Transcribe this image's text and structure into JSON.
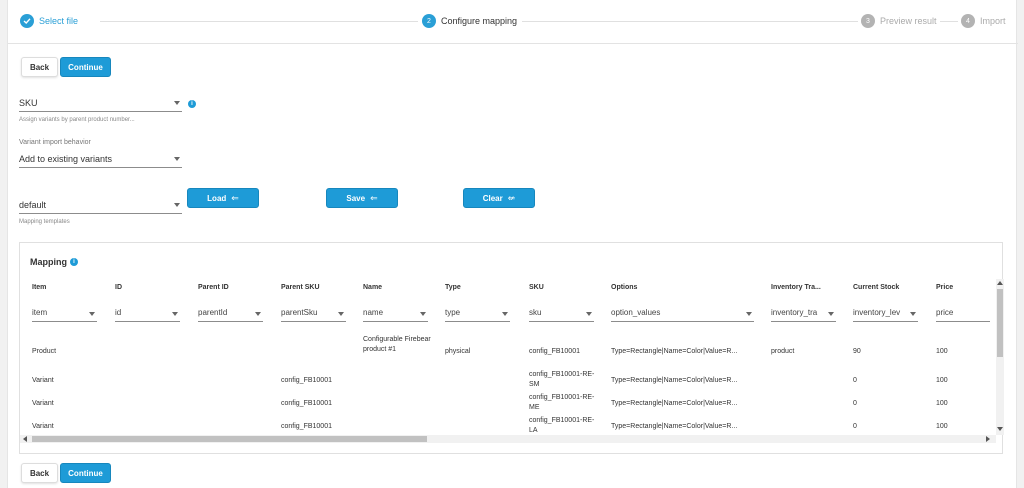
{
  "stepper": {
    "steps": [
      {
        "num": "✓",
        "label": "Select file",
        "state": "done"
      },
      {
        "num": "2",
        "label": "Configure mapping",
        "state": "active"
      },
      {
        "num": "3",
        "label": "Preview result",
        "state": "todo"
      },
      {
        "num": "4",
        "label": "Import",
        "state": "todo"
      }
    ]
  },
  "top_buttons": {
    "back_label": "Back",
    "continue_label": "Continue"
  },
  "bottom_buttons": {
    "back_label": "Back",
    "continue_label": "Continue"
  },
  "sku_field": {
    "value": "SKU",
    "help": "Assign variants by parent product number..."
  },
  "variant_behavior": {
    "caption": "Variant import behavior",
    "value": "Add to existing variants"
  },
  "template_field": {
    "value": "default",
    "help": "Mapping templates"
  },
  "template_buttons": {
    "load_label": "Load",
    "save_label": "Save",
    "clear_label": "Clear"
  },
  "mapping": {
    "title": "Mapping",
    "columns": [
      {
        "header": "Item",
        "select": "item"
      },
      {
        "header": "ID",
        "select": "id"
      },
      {
        "header": "Parent ID",
        "select": "parentId"
      },
      {
        "header": "Parent SKU",
        "select": "parentSku"
      },
      {
        "header": "Name",
        "select": "name"
      },
      {
        "header": "Type",
        "select": "type"
      },
      {
        "header": "SKU",
        "select": "sku"
      },
      {
        "header": "Options",
        "select": "option_values"
      },
      {
        "header": "Inventory Tra...",
        "select": "inventory_tra"
      },
      {
        "header": "Current Stock",
        "select": "inventory_lev"
      },
      {
        "header": "Price",
        "select": "price"
      }
    ],
    "rows": [
      {
        "item": "Product",
        "id": "",
        "parent_id": "",
        "parent_sku": "",
        "name": "Configurable Firebear product #1",
        "type": "physical",
        "sku": "config_FB10001",
        "options": "Type=Rectangle|Name=Color|Value=R...",
        "inventory": "product",
        "stock": "90",
        "price": "100"
      },
      {
        "item": "Variant",
        "id": "",
        "parent_id": "",
        "parent_sku": "config_FB10001",
        "name": "",
        "type": "",
        "sku": "config_FB10001-RE-SM",
        "options": "Type=Rectangle|Name=Color|Value=R...",
        "inventory": "",
        "stock": "0",
        "price": "100"
      },
      {
        "item": "Variant",
        "id": "",
        "parent_id": "",
        "parent_sku": "config_FB10001",
        "name": "",
        "type": "",
        "sku": "config_FB10001-RE-ME",
        "options": "Type=Rectangle|Name=Color|Value=R...",
        "inventory": "",
        "stock": "0",
        "price": "100"
      },
      {
        "item": "Variant",
        "id": "",
        "parent_id": "",
        "parent_sku": "config_FB10001",
        "name": "",
        "type": "",
        "sku": "config_FB10001-RE-LA",
        "options": "Type=Rectangle|Name=Color|Value=R...",
        "inventory": "",
        "stock": "0",
        "price": "100"
      }
    ]
  },
  "colors": {
    "accent": "#1e9bd7",
    "muted": "#b3b3b3"
  }
}
